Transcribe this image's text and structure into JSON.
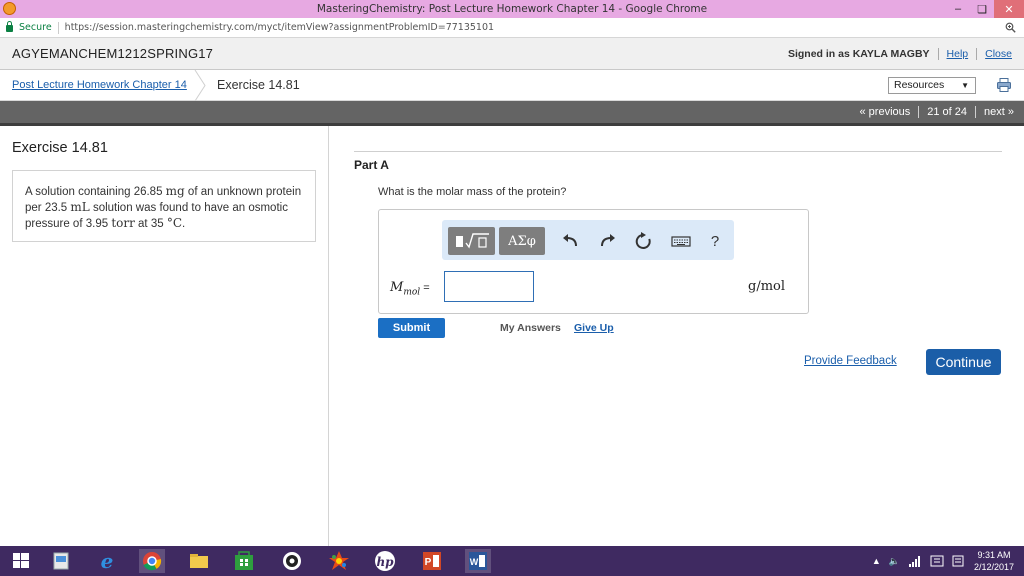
{
  "window": {
    "title": "MasteringChemistry: Post Lecture Homework Chapter 14 - Google Chrome"
  },
  "addressbar": {
    "secure_label": "Secure",
    "url": "https://session.masteringchemistry.com/myct/itemView?assignmentProblemID=77135101"
  },
  "course_header": {
    "course_name": "AGYEMANCHEM1212SPRING17",
    "signed_in": "Signed in as KAYLA MAGBY",
    "help": "Help",
    "close": "Close"
  },
  "breadcrumb": {
    "assignment": "Post Lecture Homework Chapter 14",
    "current": "Exercise 14.81",
    "resources": "Resources"
  },
  "pager": {
    "previous": "« previous",
    "position": "21 of 24",
    "next": "next »"
  },
  "problem": {
    "title": "Exercise 14.81",
    "text_1": "A solution containing 26.85 ",
    "unit_mg": "mg",
    "text_2": " of an unknown protein per 23.5 ",
    "unit_ml": "mL",
    "text_3": " solution was found to have an osmotic pressure of 3.95 ",
    "unit_torr": "torr",
    "text_4": " at 35 ",
    "unit_c": "°C",
    "text_5": "."
  },
  "part": {
    "title": "Part A",
    "question": "What is the molar mass of the protein?",
    "toolbar": {
      "greek_label": "ΑΣφ",
      "help_label": "?"
    },
    "answer": {
      "var_main": "M",
      "var_sub": "mol",
      "equals": " =",
      "value": "",
      "unit": "g/mol"
    },
    "submit": "Submit",
    "my_answers": "My Answers",
    "give_up": "Give Up"
  },
  "footer": {
    "feedback": "Provide Feedback",
    "continue": "Continue"
  },
  "taskbar": {
    "time": "9:31 AM",
    "date": "2/12/2017"
  },
  "colors": {
    "titlebar": "#e7a9e2",
    "link": "#1a5eab",
    "primary_button": "#1b6fc4",
    "taskbar": "#3f2a61",
    "navbar": "#646464"
  }
}
